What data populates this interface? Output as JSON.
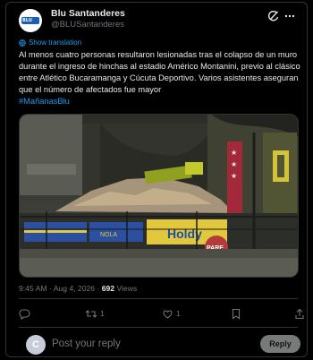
{
  "tweet": {
    "author_name": "Blu Santanderes",
    "author_handle": "@BLUSantanderes",
    "avatar_label": "BLU",
    "show_translation": "Show translation",
    "text": "Al menos cuatro personas resultaron lesionadas tras el colapso de un muro durante el ingreso de hinchas al estadio Américo Montanini, previo al clásico entre Atlético Bucaramanga y Cúcuta Deportivo. Varios asistentes aseguran que el número de afectados fue mayor",
    "hashtag": "#MañanasBlu",
    "time": "9:45 AM",
    "date": "Aug 4, 2026",
    "views_count": "692",
    "views_label": "Views"
  },
  "actions": {
    "retweets": "1",
    "likes": "1"
  },
  "media": {
    "banner_text": "Holdy",
    "pare_sign": "PARE",
    "ad_text": "NOLA"
  },
  "reply": {
    "avatar_letter": "C",
    "placeholder": "Post your reply",
    "button_label": "Reply"
  },
  "colors": {
    "accent": "#1d9bf0",
    "muted": "#71767b",
    "text": "#e7e9ea",
    "background": "#000000"
  },
  "icons": [
    "grok-icon",
    "more-icon",
    "translate-icon",
    "reply-icon",
    "retweet-icon",
    "like-icon",
    "bookmark-icon",
    "share-icon"
  ]
}
